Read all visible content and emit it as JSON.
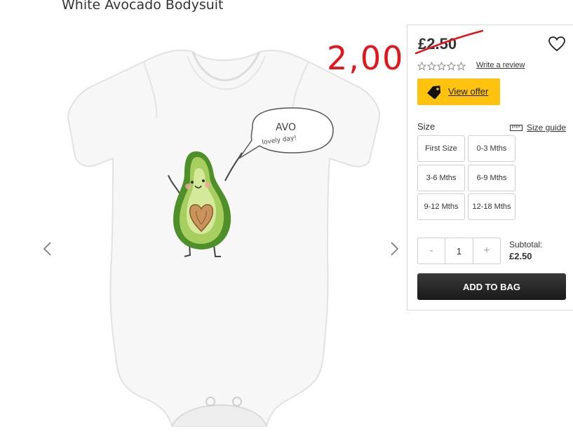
{
  "product": {
    "title": "White Avocado Bodysuit"
  },
  "annotation": {
    "handwritten_price": "2,00"
  },
  "purchase": {
    "price": "£2.50",
    "write_review": "Write a review",
    "rating_stars": 0,
    "offer_label": "View offer",
    "size_label": "Size",
    "size_guide": "Size guide",
    "sizes": [
      "First Size",
      "0-3 Mths",
      "3-6 Mths",
      "6-9 Mths",
      "9-12 Mths",
      "12-18 Mths"
    ],
    "quantity": "1",
    "minus": "-",
    "plus": "+",
    "subtotal_label": "Subtotal:",
    "subtotal_value": "£2.50",
    "add_to_bag": "ADD TO BAG"
  },
  "print": {
    "speech_line1": "AVO",
    "speech_line2": "lovely day!"
  },
  "colors": {
    "accent_yellow": "#ffc20e",
    "annotation_red": "#e3141b",
    "button_dark": "#222222",
    "avocado_green": "#8bbf45"
  }
}
